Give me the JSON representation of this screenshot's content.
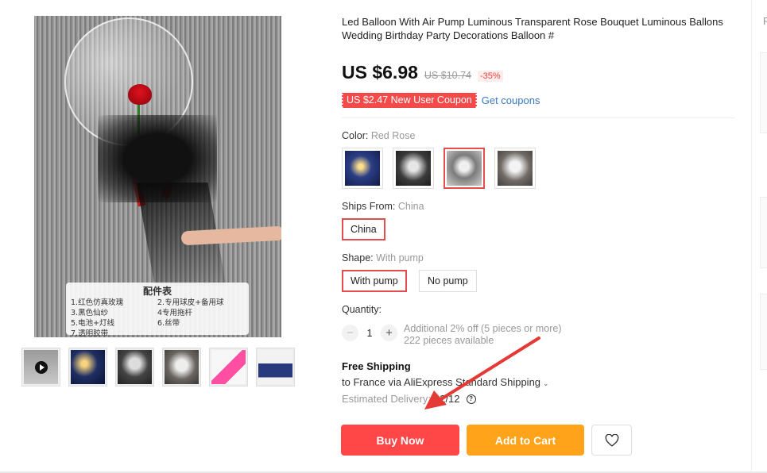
{
  "product": {
    "title": "Led Balloon With Air Pump Luminous Transparent Rose Bouquet Luminous Ballons Wedding Birthday Party Decorations Balloon #",
    "price": "US $6.98",
    "original_price": "US $10.74",
    "discount": "-35%",
    "coupon": "US $2.47 New User Coupon",
    "get_coupons": "Get coupons"
  },
  "image_card": {
    "title": "配件表",
    "items": [
      "1.红色仿真玫瑰",
      "2.专用球皮+备用球",
      "3.黑色仙纱",
      "4专用拖杆",
      "5.电池+灯线",
      "6.丝带",
      "7.透明胶带"
    ]
  },
  "color": {
    "label": "Color: ",
    "value": "Red Rose",
    "selected_index": 2
  },
  "ships_from": {
    "label": "Ships From: ",
    "value": "China",
    "options": [
      "China"
    ]
  },
  "shape": {
    "label": "Shape: ",
    "value": "With pump",
    "options": [
      "With pump",
      "No pump"
    ]
  },
  "quantity": {
    "label": "Quantity:",
    "value": "1",
    "minus": "−",
    "plus": "+",
    "offer": "Additional 2% off (5 pieces or more)",
    "available": "222 pieces available"
  },
  "shipping": {
    "title": "Free Shipping",
    "to": "to France via AliExpress Standard Shipping",
    "estimated_label": "Estimated Delivery:",
    "estimated_date": "02/12"
  },
  "actions": {
    "buy_now": "Buy Now",
    "add_to_cart": "Add to Cart"
  },
  "right_edge_letter": "F",
  "colors": {
    "buy_now": "#ff4747",
    "add_to_cart": "#ffa31a",
    "coupon": "#f44a4a",
    "link": "#3a78c3",
    "selected_border": "#e54c4c",
    "annotation_arrow": "#e53935"
  }
}
